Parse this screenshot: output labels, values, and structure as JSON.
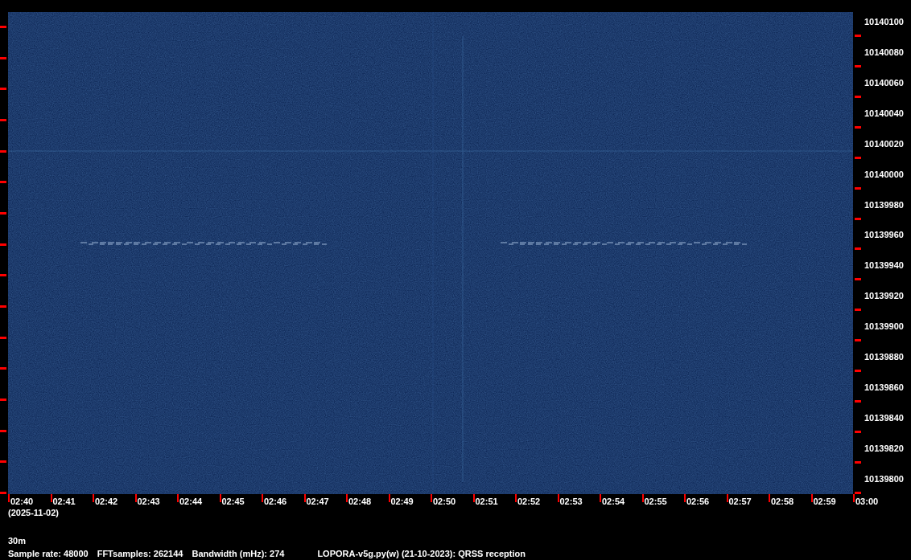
{
  "frequency_labels": [
    "10140100",
    "10140080",
    "10140060",
    "10140040",
    "10140020",
    "10140000",
    "10139980",
    "10139960",
    "10139940",
    "10139920",
    "10139900",
    "10139880",
    "10139860",
    "10139840",
    "10139820",
    "10139800"
  ],
  "time_labels": [
    "02:40",
    "02:41",
    "02:42",
    "02:43",
    "02:44",
    "02:45",
    "02:46",
    "02:47",
    "02:48",
    "02:49",
    "02:50",
    "02:51",
    "02:52",
    "02:53",
    "02:54",
    "02:55",
    "02:56",
    "02:57",
    "02:58",
    "02:59",
    "03:00"
  ],
  "date": "(2025-11-02)",
  "band": "30m",
  "info": [
    "Sample rate: 48000",
    "FFTsamples: 262144",
    "Bandwidth (mHz): 274",
    "LOPORA-v5g.py(w) (21-10-2023): QRSS reception"
  ]
}
